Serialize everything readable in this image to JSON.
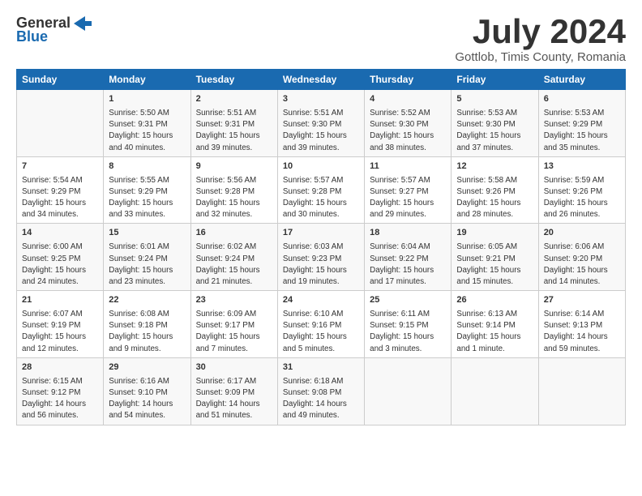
{
  "header": {
    "logo_general": "General",
    "logo_blue": "Blue",
    "month": "July 2024",
    "location": "Gottlob, Timis County, Romania"
  },
  "days_of_week": [
    "Sunday",
    "Monday",
    "Tuesday",
    "Wednesday",
    "Thursday",
    "Friday",
    "Saturday"
  ],
  "weeks": [
    [
      {
        "day": "",
        "info": ""
      },
      {
        "day": "1",
        "info": "Sunrise: 5:50 AM\nSunset: 9:31 PM\nDaylight: 15 hours\nand 40 minutes."
      },
      {
        "day": "2",
        "info": "Sunrise: 5:51 AM\nSunset: 9:31 PM\nDaylight: 15 hours\nand 39 minutes."
      },
      {
        "day": "3",
        "info": "Sunrise: 5:51 AM\nSunset: 9:30 PM\nDaylight: 15 hours\nand 39 minutes."
      },
      {
        "day": "4",
        "info": "Sunrise: 5:52 AM\nSunset: 9:30 PM\nDaylight: 15 hours\nand 38 minutes."
      },
      {
        "day": "5",
        "info": "Sunrise: 5:53 AM\nSunset: 9:30 PM\nDaylight: 15 hours\nand 37 minutes."
      },
      {
        "day": "6",
        "info": "Sunrise: 5:53 AM\nSunset: 9:29 PM\nDaylight: 15 hours\nand 35 minutes."
      }
    ],
    [
      {
        "day": "7",
        "info": "Sunrise: 5:54 AM\nSunset: 9:29 PM\nDaylight: 15 hours\nand 34 minutes."
      },
      {
        "day": "8",
        "info": "Sunrise: 5:55 AM\nSunset: 9:29 PM\nDaylight: 15 hours\nand 33 minutes."
      },
      {
        "day": "9",
        "info": "Sunrise: 5:56 AM\nSunset: 9:28 PM\nDaylight: 15 hours\nand 32 minutes."
      },
      {
        "day": "10",
        "info": "Sunrise: 5:57 AM\nSunset: 9:28 PM\nDaylight: 15 hours\nand 30 minutes."
      },
      {
        "day": "11",
        "info": "Sunrise: 5:57 AM\nSunset: 9:27 PM\nDaylight: 15 hours\nand 29 minutes."
      },
      {
        "day": "12",
        "info": "Sunrise: 5:58 AM\nSunset: 9:26 PM\nDaylight: 15 hours\nand 28 minutes."
      },
      {
        "day": "13",
        "info": "Sunrise: 5:59 AM\nSunset: 9:26 PM\nDaylight: 15 hours\nand 26 minutes."
      }
    ],
    [
      {
        "day": "14",
        "info": "Sunrise: 6:00 AM\nSunset: 9:25 PM\nDaylight: 15 hours\nand 24 minutes."
      },
      {
        "day": "15",
        "info": "Sunrise: 6:01 AM\nSunset: 9:24 PM\nDaylight: 15 hours\nand 23 minutes."
      },
      {
        "day": "16",
        "info": "Sunrise: 6:02 AM\nSunset: 9:24 PM\nDaylight: 15 hours\nand 21 minutes."
      },
      {
        "day": "17",
        "info": "Sunrise: 6:03 AM\nSunset: 9:23 PM\nDaylight: 15 hours\nand 19 minutes."
      },
      {
        "day": "18",
        "info": "Sunrise: 6:04 AM\nSunset: 9:22 PM\nDaylight: 15 hours\nand 17 minutes."
      },
      {
        "day": "19",
        "info": "Sunrise: 6:05 AM\nSunset: 9:21 PM\nDaylight: 15 hours\nand 15 minutes."
      },
      {
        "day": "20",
        "info": "Sunrise: 6:06 AM\nSunset: 9:20 PM\nDaylight: 15 hours\nand 14 minutes."
      }
    ],
    [
      {
        "day": "21",
        "info": "Sunrise: 6:07 AM\nSunset: 9:19 PM\nDaylight: 15 hours\nand 12 minutes."
      },
      {
        "day": "22",
        "info": "Sunrise: 6:08 AM\nSunset: 9:18 PM\nDaylight: 15 hours\nand 9 minutes."
      },
      {
        "day": "23",
        "info": "Sunrise: 6:09 AM\nSunset: 9:17 PM\nDaylight: 15 hours\nand 7 minutes."
      },
      {
        "day": "24",
        "info": "Sunrise: 6:10 AM\nSunset: 9:16 PM\nDaylight: 15 hours\nand 5 minutes."
      },
      {
        "day": "25",
        "info": "Sunrise: 6:11 AM\nSunset: 9:15 PM\nDaylight: 15 hours\nand 3 minutes."
      },
      {
        "day": "26",
        "info": "Sunrise: 6:13 AM\nSunset: 9:14 PM\nDaylight: 15 hours\nand 1 minute."
      },
      {
        "day": "27",
        "info": "Sunrise: 6:14 AM\nSunset: 9:13 PM\nDaylight: 14 hours\nand 59 minutes."
      }
    ],
    [
      {
        "day": "28",
        "info": "Sunrise: 6:15 AM\nSunset: 9:12 PM\nDaylight: 14 hours\nand 56 minutes."
      },
      {
        "day": "29",
        "info": "Sunrise: 6:16 AM\nSunset: 9:10 PM\nDaylight: 14 hours\nand 54 minutes."
      },
      {
        "day": "30",
        "info": "Sunrise: 6:17 AM\nSunset: 9:09 PM\nDaylight: 14 hours\nand 51 minutes."
      },
      {
        "day": "31",
        "info": "Sunrise: 6:18 AM\nSunset: 9:08 PM\nDaylight: 14 hours\nand 49 minutes."
      },
      {
        "day": "",
        "info": ""
      },
      {
        "day": "",
        "info": ""
      },
      {
        "day": "",
        "info": ""
      }
    ]
  ]
}
